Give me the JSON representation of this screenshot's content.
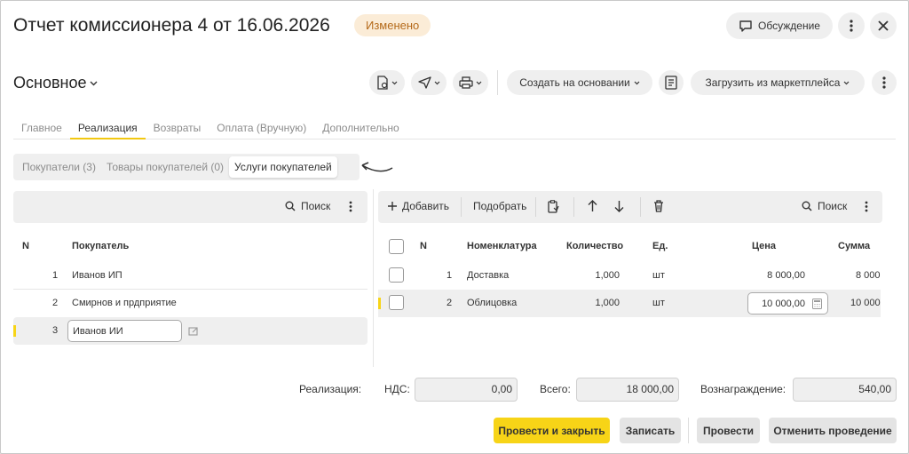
{
  "header": {
    "title": "Отчет комиссионера 4 от 16.06.2026",
    "status_badge": "Изменено",
    "discussion_label": "Обсуждение"
  },
  "toolbar": {
    "section_label": "Основное",
    "create_based_label": "Создать на основании",
    "load_marketplace_label": "Загрузить из маркетплейса"
  },
  "tabs": [
    {
      "label": "Главное",
      "active": false
    },
    {
      "label": "Реализация",
      "active": true
    },
    {
      "label": "Возвраты",
      "active": false
    },
    {
      "label": "Оплата (Вручную)",
      "active": false
    },
    {
      "label": "Дополнительно",
      "active": false
    }
  ],
  "subtabs": [
    {
      "label": "Покупатели (3)",
      "active": false
    },
    {
      "label": "Товары покупателей (0)",
      "active": false
    },
    {
      "label": "Услуги покупателей",
      "active": true
    }
  ],
  "left_panel": {
    "search_label": "Поиск",
    "columns": {
      "n": "N",
      "buyer": "Покупатель"
    },
    "rows": [
      {
        "n": "1",
        "buyer": "Иванов ИП"
      },
      {
        "n": "2",
        "buyer": "Смирнов и прдприятие"
      },
      {
        "n": "3",
        "buyer": "Иванов ИИ"
      }
    ]
  },
  "right_panel": {
    "add_label": "Добавить",
    "pick_label": "Подобрать",
    "search_label": "Поиск",
    "columns": {
      "n": "N",
      "item": "Номенклатура",
      "qty": "Количество",
      "unit": "Ед.",
      "price": "Цена",
      "sum": "Сумма"
    },
    "rows": [
      {
        "n": "1",
        "item": "Доставка",
        "qty": "1,000",
        "unit": "шт",
        "price": "8 000,00",
        "sum": "8 000"
      },
      {
        "n": "2",
        "item": "Облицовка",
        "qty": "1,000",
        "unit": "шт",
        "price": "10 000,00",
        "sum": "10 000"
      }
    ]
  },
  "totals": {
    "realization_label": "Реализация:",
    "vat_label": "НДС:",
    "vat_value": "0,00",
    "total_label": "Всего:",
    "total_value": "18 000,00",
    "reward_label": "Вознаграждение:",
    "reward_value": "540,00"
  },
  "footer": {
    "post_close_label": "Провести и закрыть",
    "save_label": "Записать",
    "post_label": "Провести",
    "cancel_post_label": "Отменить проведение"
  },
  "colors": {
    "accent": "#f7d417",
    "badge_bg": "#fbecd7",
    "badge_text": "#b56a1a"
  }
}
